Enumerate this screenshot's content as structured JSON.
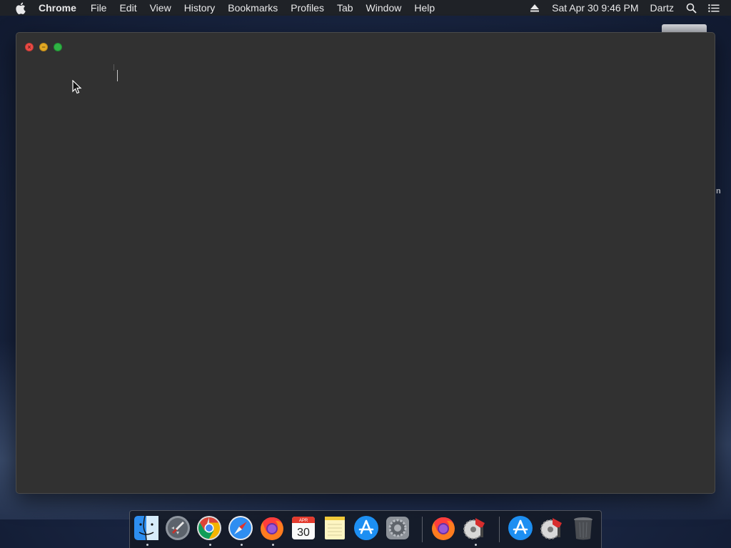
{
  "menubar": {
    "apple_icon": "apple-logo-icon",
    "app_name": "Chrome",
    "items": [
      "File",
      "Edit",
      "View",
      "History",
      "Bookmarks",
      "Profiles",
      "Tab",
      "Window",
      "Help"
    ],
    "datetime": "Sat Apr 30  9:46 PM",
    "user": "Dartz",
    "status_icons": [
      "eject-icon",
      "spotlight-search-icon",
      "notification-center-icon"
    ]
  },
  "desktop": {
    "partial_label": "n"
  },
  "window": {
    "title": "",
    "traffic_lights": [
      "close",
      "minimize",
      "fullscreen"
    ],
    "colors": {
      "background": "#313131",
      "close": "#ec4b45",
      "minimize": "#e3a923",
      "fullscreen": "#2fb344"
    }
  },
  "dock": {
    "items": [
      {
        "name": "finder-icon",
        "running": true
      },
      {
        "name": "launchpad-icon",
        "running": false
      },
      {
        "name": "chrome-icon",
        "running": true
      },
      {
        "name": "safari-icon",
        "running": true
      },
      {
        "name": "firefox-icon",
        "running": true
      },
      {
        "name": "calendar-icon",
        "running": false,
        "month": "APR",
        "day": "30"
      },
      {
        "name": "notes-icon",
        "running": false
      },
      {
        "name": "app-store-icon",
        "running": false
      },
      {
        "name": "system-preferences-icon",
        "running": false
      },
      {
        "name": "firefox-icon",
        "running": false
      },
      {
        "name": "saw-app-icon",
        "running": true
      },
      {
        "name": "app-store-downloads-icon",
        "running": false
      },
      {
        "name": "saw-app-icon",
        "running": false
      },
      {
        "name": "trash-icon",
        "running": false
      }
    ]
  }
}
